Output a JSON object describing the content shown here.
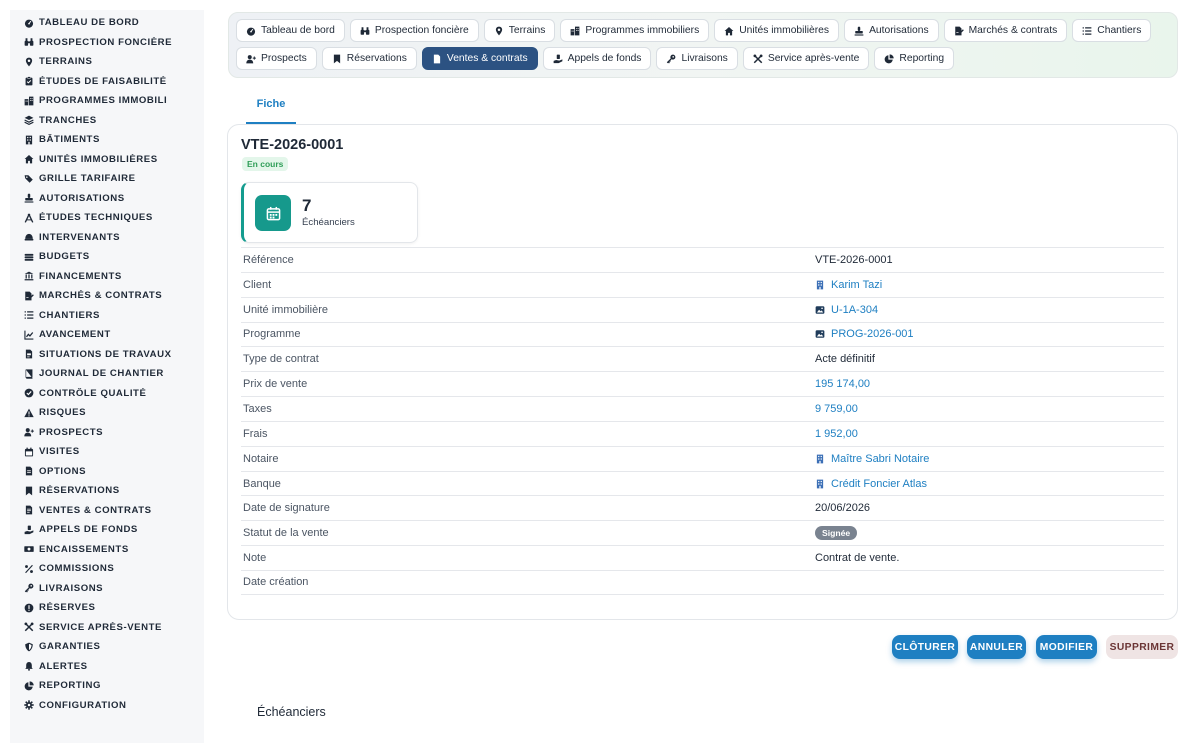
{
  "sidebar": {
    "items": [
      {
        "label": "TABLEAU DE BORD",
        "icon": "dashboard-icon"
      },
      {
        "label": "PROSPECTION FONCIÈRE",
        "icon": "binoculars-icon"
      },
      {
        "label": "TERRAINS",
        "icon": "map-pin-icon"
      },
      {
        "label": "ÉTUDES DE FAISABILITÉ",
        "icon": "clipboard-icon"
      },
      {
        "label": "PROGRAMMES IMMOBILI",
        "icon": "buildings-icon"
      },
      {
        "label": "TRANCHES",
        "icon": "layers-icon"
      },
      {
        "label": "BÂTIMENTS",
        "icon": "building-icon"
      },
      {
        "label": "UNITÉS IMMOBILIÈRES",
        "icon": "home-icon"
      },
      {
        "label": "GRILLE TARIFAIRE",
        "icon": "tags-icon"
      },
      {
        "label": "AUTORISATIONS",
        "icon": "stamp-icon"
      },
      {
        "label": "ÉTUDES TECHNIQUES",
        "icon": "compass-icon"
      },
      {
        "label": "INTERVENANTS",
        "icon": "hard-hat-icon"
      },
      {
        "label": "BUDGETS",
        "icon": "coins-icon"
      },
      {
        "label": "FINANCEMENTS",
        "icon": "bank-icon"
      },
      {
        "label": "MARCHÉS & CONTRATS",
        "icon": "file-signature-icon"
      },
      {
        "label": "CHANTIERS",
        "icon": "list-icon"
      },
      {
        "label": "AVANCEMENT",
        "icon": "chart-line-icon"
      },
      {
        "label": "SITUATIONS DE TRAVAUX",
        "icon": "file-invoice-icon"
      },
      {
        "label": "JOURNAL DE CHANTIER",
        "icon": "book-icon"
      },
      {
        "label": "CONTRÔLE QUALITÉ",
        "icon": "check-badge-icon"
      },
      {
        "label": "RISQUES",
        "icon": "warning-icon"
      },
      {
        "label": "PROSPECTS",
        "icon": "user-plus-icon"
      },
      {
        "label": "VISITES",
        "icon": "calendar-icon"
      },
      {
        "label": "OPTIONS",
        "icon": "file-icon"
      },
      {
        "label": "RÉSERVATIONS",
        "icon": "bookmark-icon"
      },
      {
        "label": "VENTES & CONTRATS",
        "icon": "file-contract-icon"
      },
      {
        "label": "APPELS DE FONDS",
        "icon": "hand-money-icon"
      },
      {
        "label": "ENCAISSEMENTS",
        "icon": "money-bill-icon"
      },
      {
        "label": "COMMISSIONS",
        "icon": "percent-icon"
      },
      {
        "label": "LIVRAISONS",
        "icon": "key-icon"
      },
      {
        "label": "RÉSERVES",
        "icon": "exclamation-circle-icon"
      },
      {
        "label": "SERVICE APRÈS-VENTE",
        "icon": "tools-icon"
      },
      {
        "label": "GARANTIES",
        "icon": "shield-icon"
      },
      {
        "label": "ALERTES",
        "icon": "bell-icon"
      },
      {
        "label": "REPORTING",
        "icon": "pie-chart-icon"
      },
      {
        "label": "CONFIGURATION",
        "icon": "gear-icon"
      }
    ]
  },
  "topnav": {
    "row1": [
      {
        "label": "Tableau de bord",
        "icon": "dashboard-icon"
      },
      {
        "label": "Prospection foncière",
        "icon": "binoculars-icon"
      },
      {
        "label": "Terrains",
        "icon": "map-pin-icon"
      },
      {
        "label": "Programmes immobiliers",
        "icon": "buildings-icon"
      },
      {
        "label": "Unités immobilières",
        "icon": "home-icon"
      },
      {
        "label": "Autorisations",
        "icon": "stamp-icon"
      },
      {
        "label": "Marchés & contrats",
        "icon": "file-signature-icon"
      },
      {
        "label": "Chantiers",
        "icon": "list-icon"
      }
    ],
    "row2": [
      {
        "label": "Prospects",
        "icon": "user-plus-icon"
      },
      {
        "label": "Réservations",
        "icon": "bookmark-icon"
      },
      {
        "label": "Ventes & contrats",
        "icon": "file-contract-icon",
        "active": true
      },
      {
        "label": "Appels de fonds",
        "icon": "hand-money-icon"
      },
      {
        "label": "Livraisons",
        "icon": "key-icon"
      },
      {
        "label": "Service après-vente",
        "icon": "tools-icon"
      },
      {
        "label": "Reporting",
        "icon": "pie-chart-icon"
      }
    ]
  },
  "tabs": {
    "fiche": "Fiche"
  },
  "record": {
    "reference": "VTE-2026-0001",
    "status": "En cours",
    "stat": {
      "count": "7",
      "label": "Échéanciers"
    }
  },
  "fields": [
    {
      "label": "Référence",
      "value": "VTE-2026-0001",
      "type": "text"
    },
    {
      "label": "Client",
      "value": "Karim Tazi",
      "type": "link",
      "icon": "building-icon"
    },
    {
      "label": "Unité immobilière",
      "value": "U-1A-304",
      "type": "link",
      "icon": "image-icon"
    },
    {
      "label": "Programme",
      "value": "PROG-2026-001",
      "type": "link",
      "icon": "image-icon"
    },
    {
      "label": "Type de contrat",
      "value": "Acte définitif",
      "type": "text"
    },
    {
      "label": "Prix de vente",
      "value": "195 174,00",
      "type": "amount"
    },
    {
      "label": "Taxes",
      "value": "9 759,00",
      "type": "amount"
    },
    {
      "label": "Frais",
      "value": "1 952,00",
      "type": "amount"
    },
    {
      "label": "Notaire",
      "value": "Maître Sabri Notaire",
      "type": "link",
      "icon": "building-icon"
    },
    {
      "label": "Banque",
      "value": "Crédit Foncier Atlas",
      "type": "link",
      "icon": "building-icon"
    },
    {
      "label": "Date de signature",
      "value": "20/06/2026",
      "type": "text"
    },
    {
      "label": "Statut de la vente",
      "value": "Signée",
      "type": "badge"
    },
    {
      "label": "Note",
      "value": "Contrat de vente.",
      "type": "text"
    },
    {
      "label": "Date création",
      "value": "",
      "type": "text"
    }
  ],
  "actions": {
    "cloturer": "CLÔTURER",
    "annuler": "ANNULER",
    "modifier": "MODIFIER",
    "supprimer": "SUPPRIMER"
  },
  "sections": {
    "echeanciers": "Échéanciers"
  },
  "colors": {
    "accent": "#1e7fc2",
    "active_nav": "#2c5282",
    "teal": "#16998c",
    "success": "#2f9e58"
  }
}
